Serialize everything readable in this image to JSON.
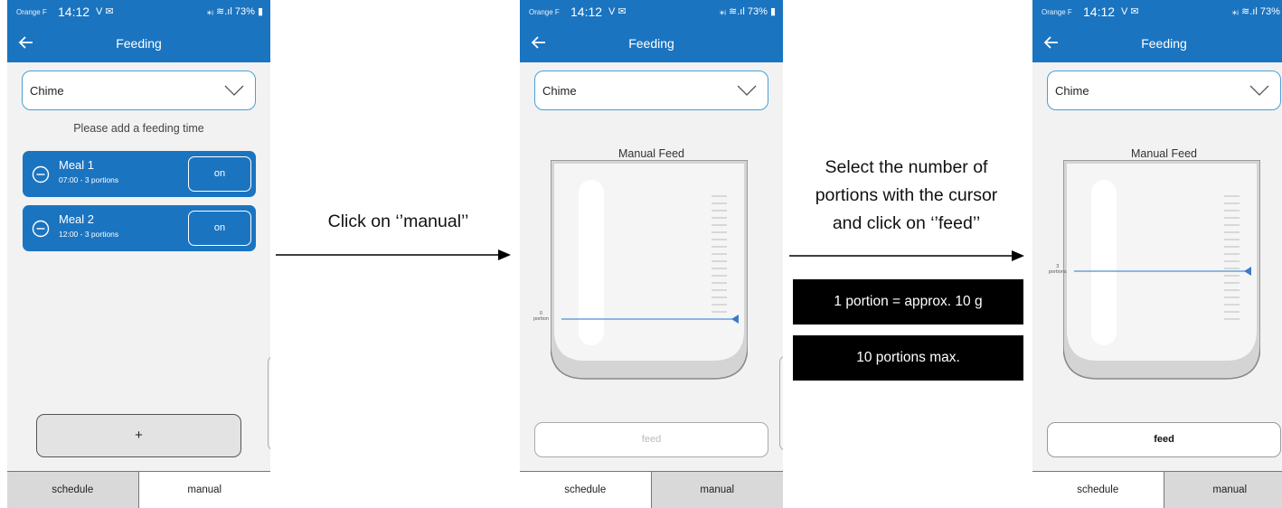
{
  "status_bar": {
    "carrier": "Orange F",
    "time": "14:12",
    "left_icons": "V ✉",
    "right_icons": "⁎ᵢ ≋.ıl",
    "battery": "73%"
  },
  "app": {
    "title": "Feeding"
  },
  "device_select": {
    "value": "Chime"
  },
  "schedule_screen": {
    "hint": "Please add a feeding time",
    "meals": [
      {
        "title": "Meal 1",
        "subtitle": "07:00 - 3 portions",
        "toggle": "on"
      },
      {
        "title": "Meal 2",
        "subtitle": "12:00 - 3 portions",
        "toggle": "on"
      }
    ],
    "add_label": "+"
  },
  "manual_screen_empty": {
    "title": "Manual Feed",
    "level_value": "0",
    "level_unit": "portion",
    "feed_label": "feed"
  },
  "manual_screen_set": {
    "title": "Manual Feed",
    "level_value": "3",
    "level_unit": "portions",
    "feed_label": "feed"
  },
  "tabs": {
    "schedule": "schedule",
    "manual": "manual"
  },
  "instructions": {
    "step1": "Click on ‘’manual’’",
    "step2_line1": "Select the number of",
    "step2_line2": "portions with the cursor",
    "step2_line3": "and click on ‘’feed’’",
    "info_portion": "1 portion = approx. 10 g",
    "info_max": "10 portions max."
  },
  "colors": {
    "brand_blue": "#1b74c0",
    "select_border": "#4a9fd8",
    "cursor_blue": "#4f8fd6",
    "tab_active_bg": "#d9d9d9",
    "info_box_bg": "#000000"
  },
  "icons": {
    "back": "arrow-left-icon",
    "dropdown": "chevron-down-icon",
    "remove": "minus-circle-icon"
  }
}
